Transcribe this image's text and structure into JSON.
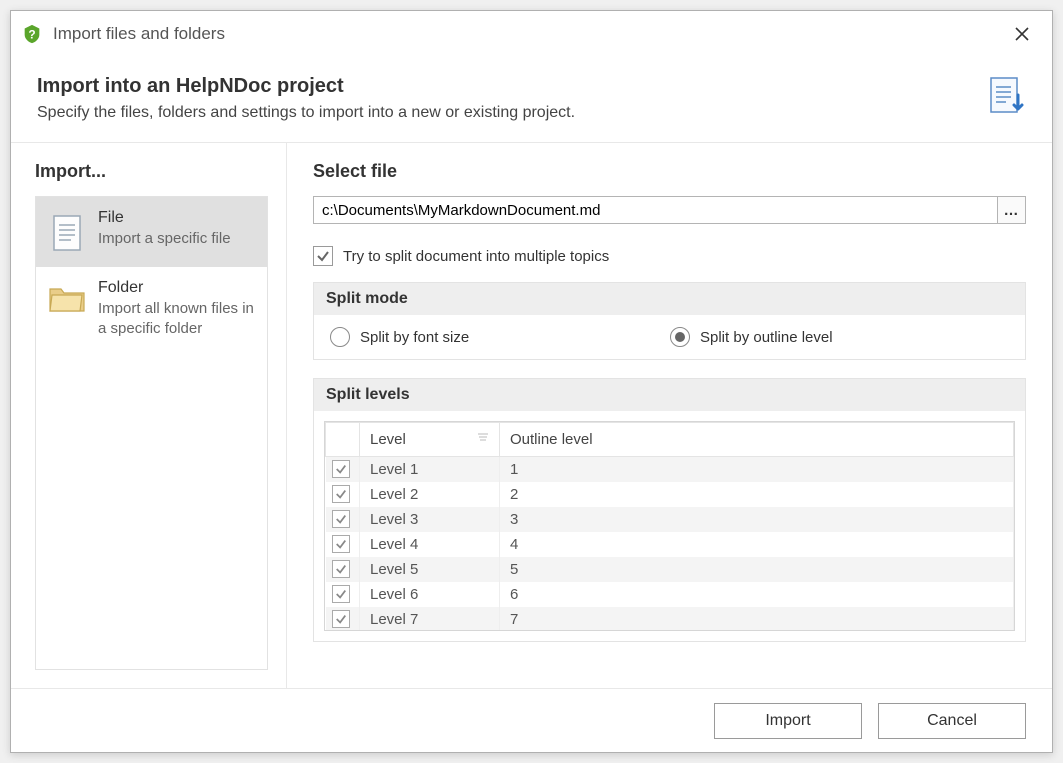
{
  "window": {
    "title": "Import files and folders"
  },
  "header": {
    "title": "Import into an HelpNDoc project",
    "subtitle": "Specify the files, folders and settings to import into a new or existing project."
  },
  "sidebar": {
    "title": "Import...",
    "items": [
      {
        "title": "File",
        "desc": "Import a specific file",
        "selected": true
      },
      {
        "title": "Folder",
        "desc": "Import all known files in a specific folder",
        "selected": false
      }
    ]
  },
  "main": {
    "select_file_label": "Select file",
    "file_path": "c:\\Documents\\MyMarkdownDocument.md",
    "browse_label": "…",
    "split_checkbox_label": "Try to split document into multiple topics",
    "split_checkbox_checked": true,
    "split_mode": {
      "title": "Split mode",
      "options": [
        {
          "label": "Split by font size",
          "selected": false
        },
        {
          "label": "Split by outline level",
          "selected": true
        }
      ]
    },
    "split_levels": {
      "title": "Split levels",
      "columns": {
        "level": "Level",
        "outline": "Outline level"
      },
      "rows": [
        {
          "checked": true,
          "level": "Level 1",
          "outline": "1"
        },
        {
          "checked": true,
          "level": "Level 2",
          "outline": "2"
        },
        {
          "checked": true,
          "level": "Level 3",
          "outline": "3"
        },
        {
          "checked": true,
          "level": "Level 4",
          "outline": "4"
        },
        {
          "checked": true,
          "level": "Level 5",
          "outline": "5"
        },
        {
          "checked": true,
          "level": "Level 6",
          "outline": "6"
        },
        {
          "checked": true,
          "level": "Level 7",
          "outline": "7"
        }
      ]
    }
  },
  "footer": {
    "import": "Import",
    "cancel": "Cancel"
  }
}
